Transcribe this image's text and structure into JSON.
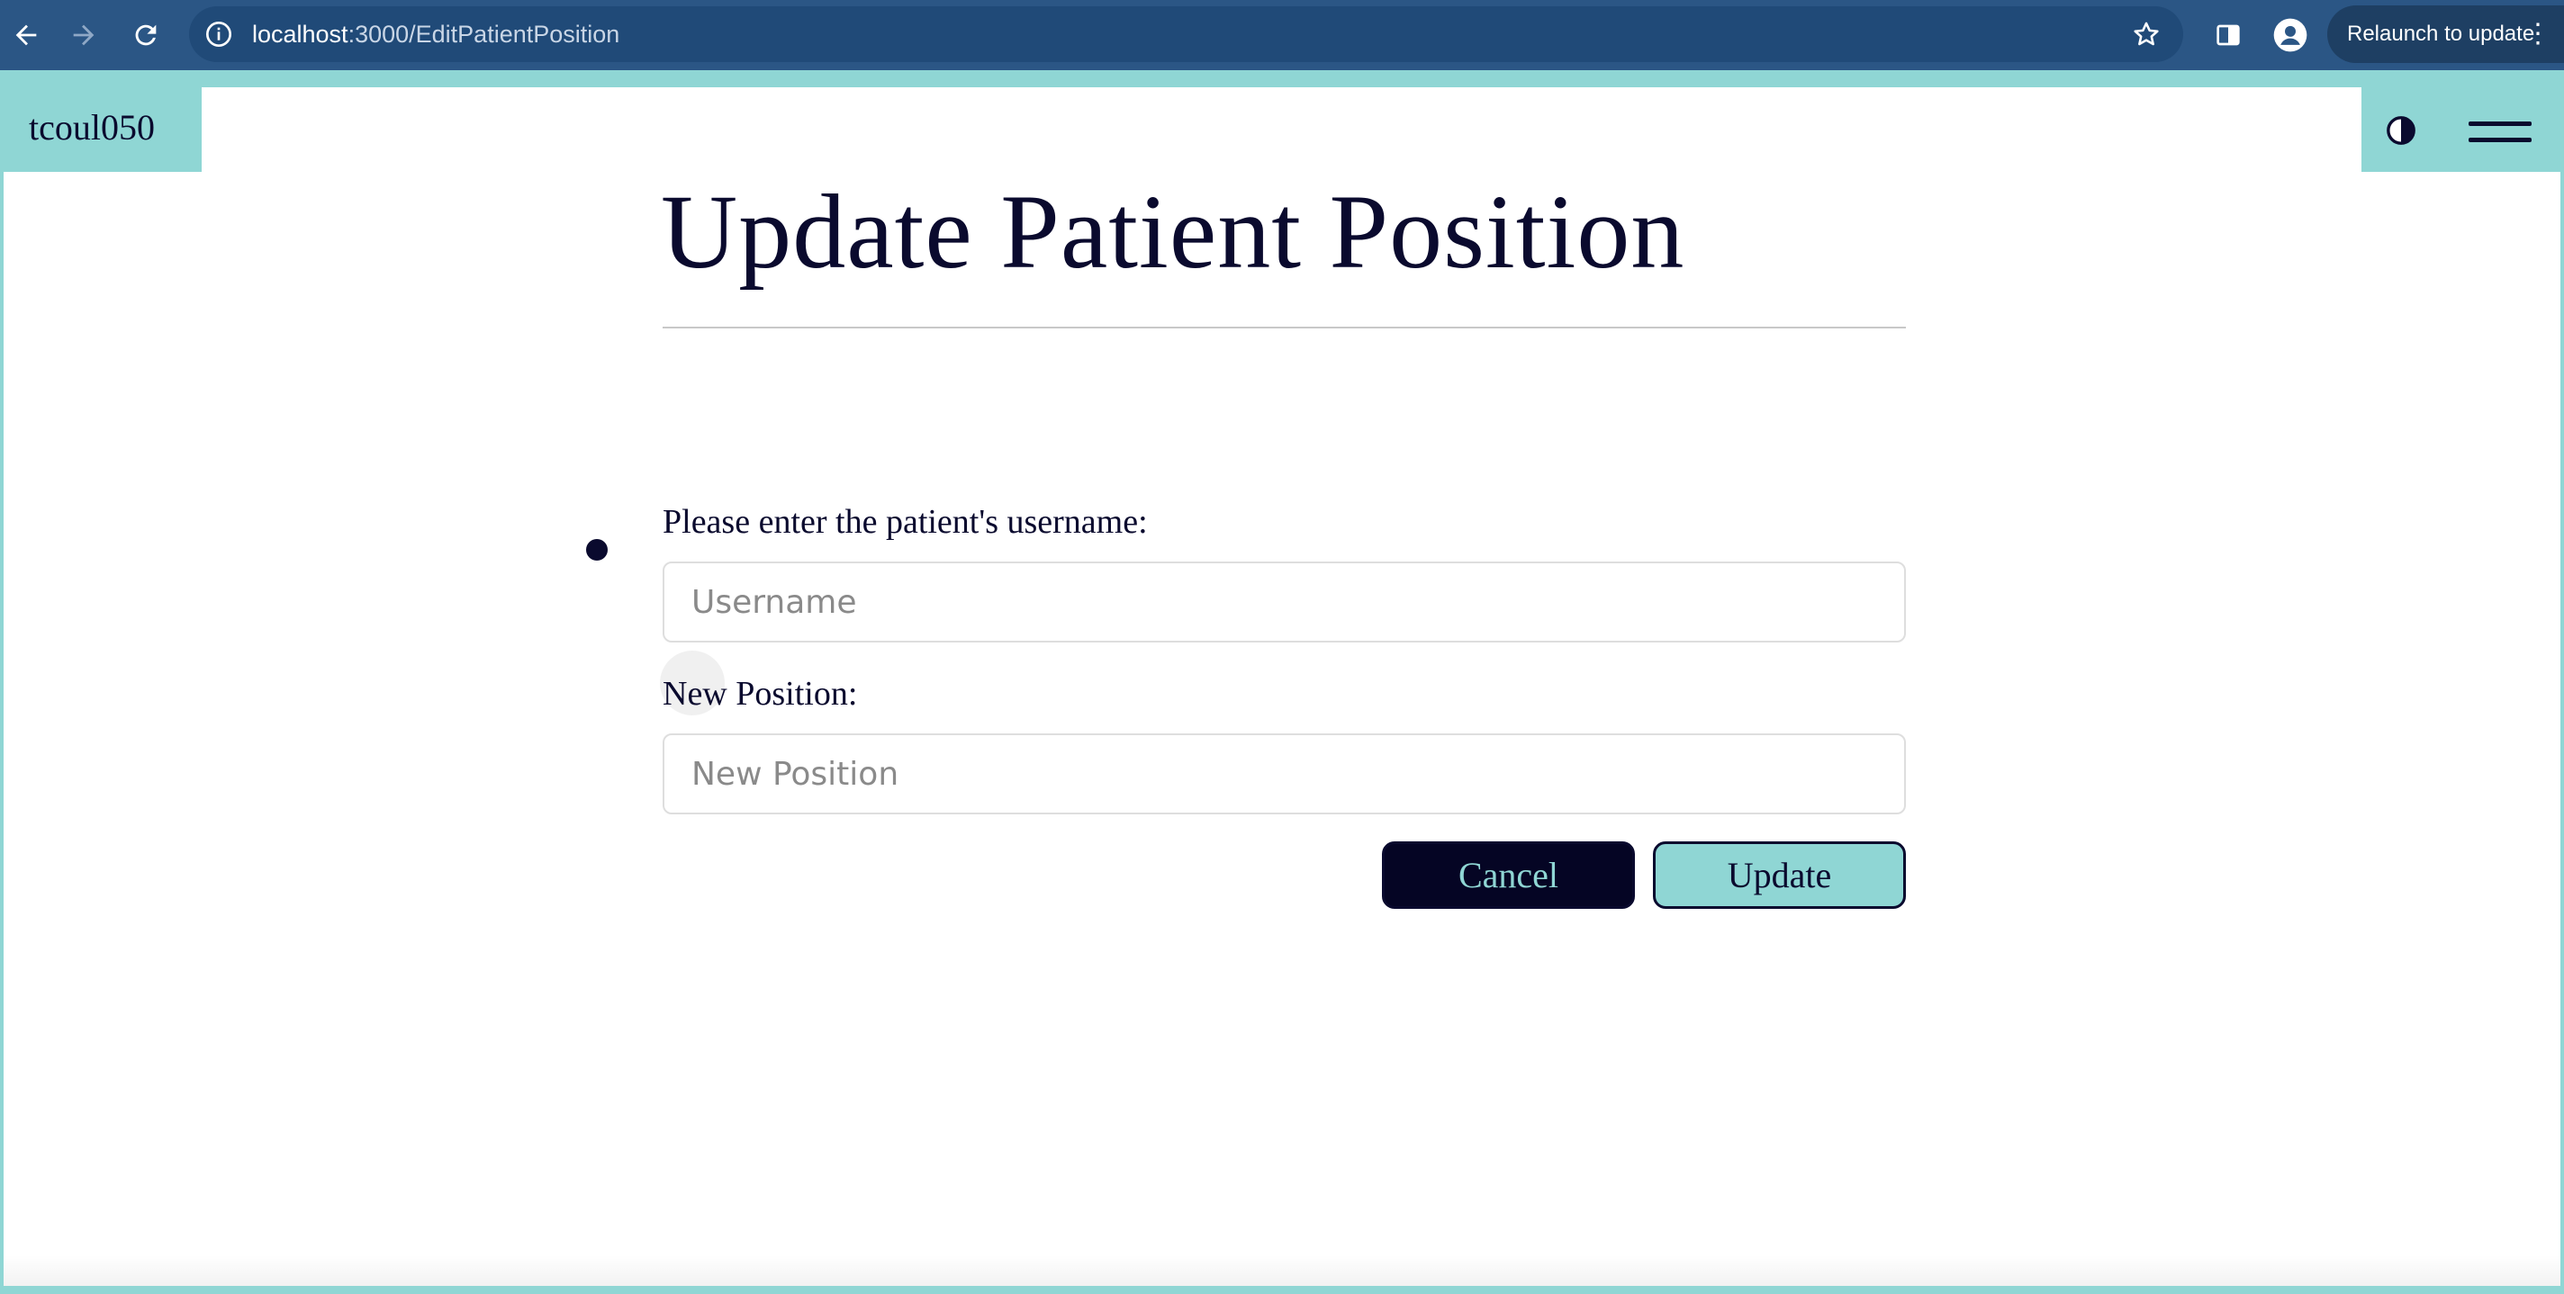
{
  "browser": {
    "url_host": "localhost",
    "url_path": ":3000/EditPatientPosition",
    "relaunch_label": "Relaunch to update",
    "menu_glyph": "⋮"
  },
  "header": {
    "brand": "tcoul050"
  },
  "form": {
    "title": "Update Patient Position",
    "username_label": "Please enter the patient's username:",
    "username_placeholder": "Username",
    "position_label": "New Position:",
    "position_placeholder": "New Position",
    "cancel_label": "Cancel",
    "update_label": "Update"
  },
  "colors": {
    "accent_teal": "#8fd6d4",
    "navy": "#0a0a2e",
    "chrome_blue": "#2b5685"
  }
}
